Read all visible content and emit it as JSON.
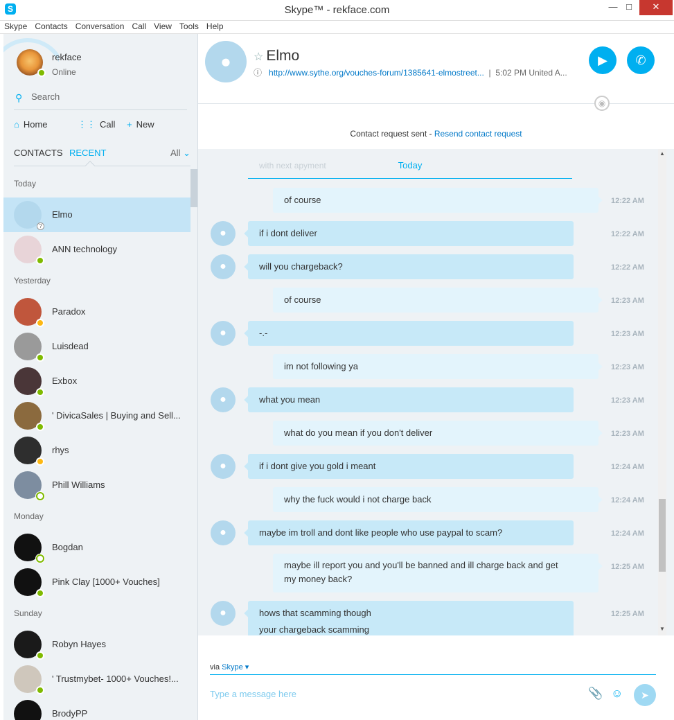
{
  "window": {
    "title": "Skype™ - rekface.com",
    "app_icon": "S",
    "controls": [
      "minimize",
      "maximize",
      "close"
    ]
  },
  "menu": [
    "Skype",
    "Contacts",
    "Conversation",
    "Call",
    "View",
    "Tools",
    "Help"
  ],
  "profile": {
    "name": "rekface",
    "status": "Online"
  },
  "search": {
    "label": "Search"
  },
  "nav": {
    "home": "Home",
    "call": "Call",
    "new": "New"
  },
  "tabs": {
    "contacts": "CONTACTS",
    "recent": "RECENT",
    "filter": "All"
  },
  "groups": {
    "today": "Today",
    "yesterday": "Yesterday",
    "monday": "Monday",
    "sunday": "Sunday"
  },
  "contacts": [
    {
      "name": "Elmo"
    },
    {
      "name": "ANN technology"
    },
    {
      "name": "Paradox"
    },
    {
      "name": "Luisdead"
    },
    {
      "name": "Exbox"
    },
    {
      "name": "' DivicaSales | Buying and Sell..."
    },
    {
      "name": "rhys"
    },
    {
      "name": "Phill Williams"
    },
    {
      "name": "Bogdan"
    },
    {
      "name": "Pink Clay [1000+ Vouches]"
    },
    {
      "name": "Robyn Hayes"
    },
    {
      "name": "' Trustmybet- 1000+ Vouches!..."
    },
    {
      "name": "BrodyPP"
    }
  ],
  "chat": {
    "name": "Elmo",
    "link": "http://www.sythe.org/vouches-forum/1385641-elmostreet...",
    "local_time": "5:02 PM United A...",
    "contact_request": "Contact request sent - ",
    "resend": "Resend contact request",
    "faded_text": "with next apyment",
    "day_label": "Today",
    "messages": [
      {
        "text": "of course",
        "time": "12:22 AM"
      },
      {
        "text": "if i dont deliver",
        "time": "12:22 AM"
      },
      {
        "text": "will you chargeback?",
        "time": "12:22 AM"
      },
      {
        "text": "of course",
        "time": "12:23 AM"
      },
      {
        "text": "-.-",
        "time": "12:23 AM"
      },
      {
        "text": "im not following ya",
        "time": "12:23 AM"
      },
      {
        "text": "what you mean",
        "time": "12:23 AM"
      },
      {
        "text": "what do you mean if you don't deliver",
        "time": "12:23 AM"
      },
      {
        "text": "if i dont give you gold i meant",
        "time": "12:24 AM"
      },
      {
        "text": "why the fuck would i not charge back",
        "time": "12:24 AM"
      },
      {
        "text": "maybe im troll and dont like people who use paypal to scam?",
        "time": "12:24 AM"
      },
      {
        "text": "maybe ill report you and you'll be banned and ill charge back and get",
        "text2": "my money back?",
        "time": "12:25 AM"
      },
      {
        "text": "hows that scamming though",
        "text2": "your chargeback scamming",
        "time": "12:25 AM"
      }
    ],
    "via_label": "via",
    "via_service": "Skype",
    "compose_placeholder": "Type a message here"
  }
}
